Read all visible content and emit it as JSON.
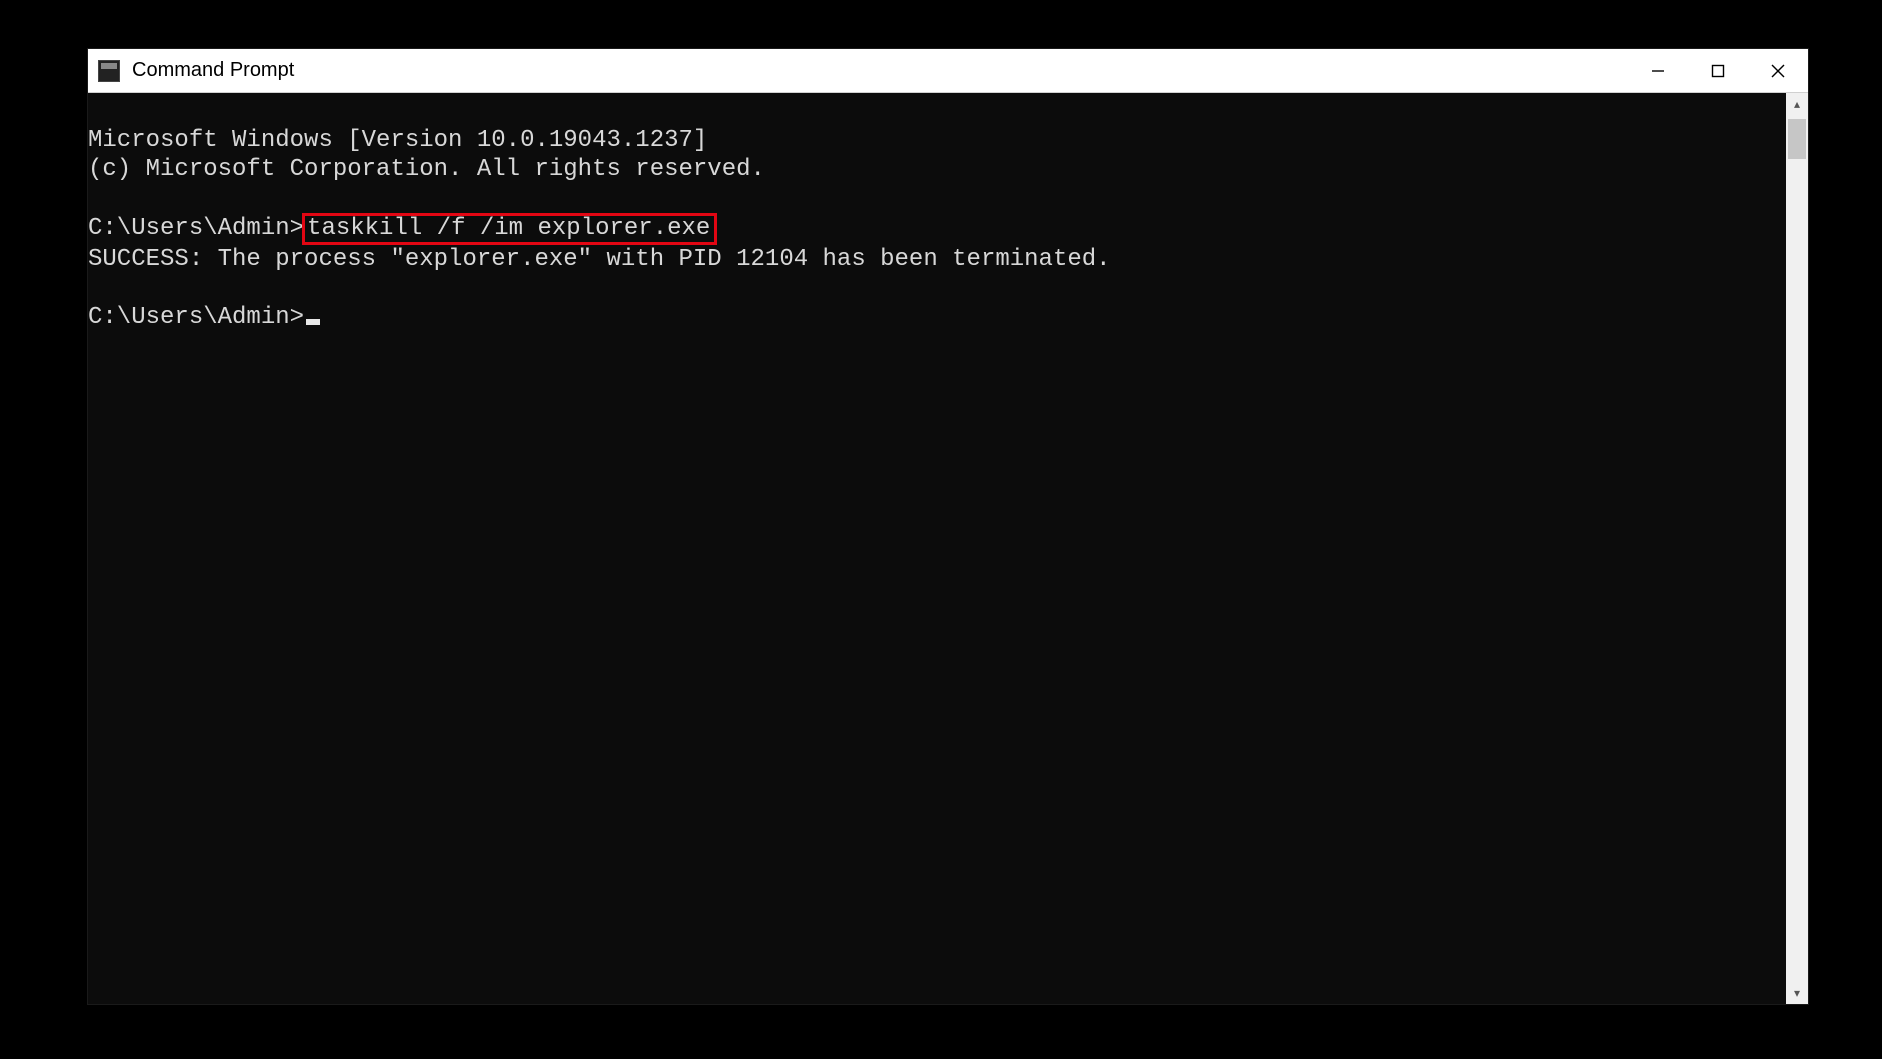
{
  "window": {
    "title": "Command Prompt"
  },
  "terminal": {
    "banner_line1": "Microsoft Windows [Version 10.0.19043.1237]",
    "banner_line2": "(c) Microsoft Corporation. All rights reserved.",
    "prompt1_prefix": "C:\\Users\\Admin>",
    "prompt1_command": "taskkill /f /im explorer.exe",
    "result_line": "SUCCESS: The process \"explorer.exe\" with PID 12104 has been terminated.",
    "prompt2_prefix": "C:\\Users\\Admin>"
  },
  "icons": {
    "minimize": "minimize-icon",
    "maximize": "maximize-icon",
    "close": "close-icon",
    "scroll_up": "▴",
    "scroll_down": "▾"
  }
}
